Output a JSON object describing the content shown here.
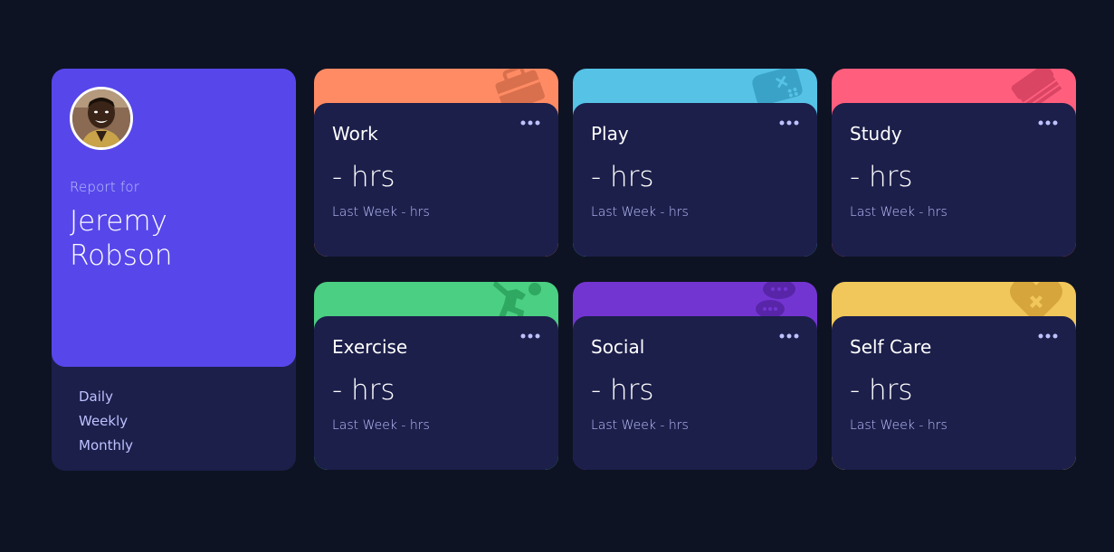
{
  "profile": {
    "report_for": "Report for",
    "name": "Jeremy Robson",
    "avatar_icon": "user-avatar",
    "periods": [
      "Daily",
      "Weekly",
      "Monthly"
    ]
  },
  "activities": [
    {
      "title": "Work",
      "current": "- hrs",
      "previous": "Last Week - hrs",
      "accent": "#ff8b64",
      "icon": "briefcase-icon"
    },
    {
      "title": "Play",
      "current": "- hrs",
      "previous": "Last Week - hrs",
      "accent": "#55c2e6",
      "icon": "gamepad-icon"
    },
    {
      "title": "Study",
      "current": "- hrs",
      "previous": "Last Week - hrs",
      "accent": "#ff5e7d",
      "icon": "book-icon"
    },
    {
      "title": "Exercise",
      "current": "- hrs",
      "previous": "Last Week - hrs",
      "accent": "#4bcf82",
      "icon": "running-icon"
    },
    {
      "title": "Social",
      "current": "- hrs",
      "previous": "Last Week - hrs",
      "accent": "#7335d2",
      "icon": "chat-icon"
    },
    {
      "title": "Self Care",
      "current": "- hrs",
      "previous": "Last Week - hrs",
      "accent": "#f1c75b",
      "icon": "heart-icon"
    }
  ],
  "colors": {
    "background": "#0e1323",
    "profile_accent": "#5747ea",
    "card_body": "#1c1f4a",
    "muted_text": "#bdc1ff"
  }
}
